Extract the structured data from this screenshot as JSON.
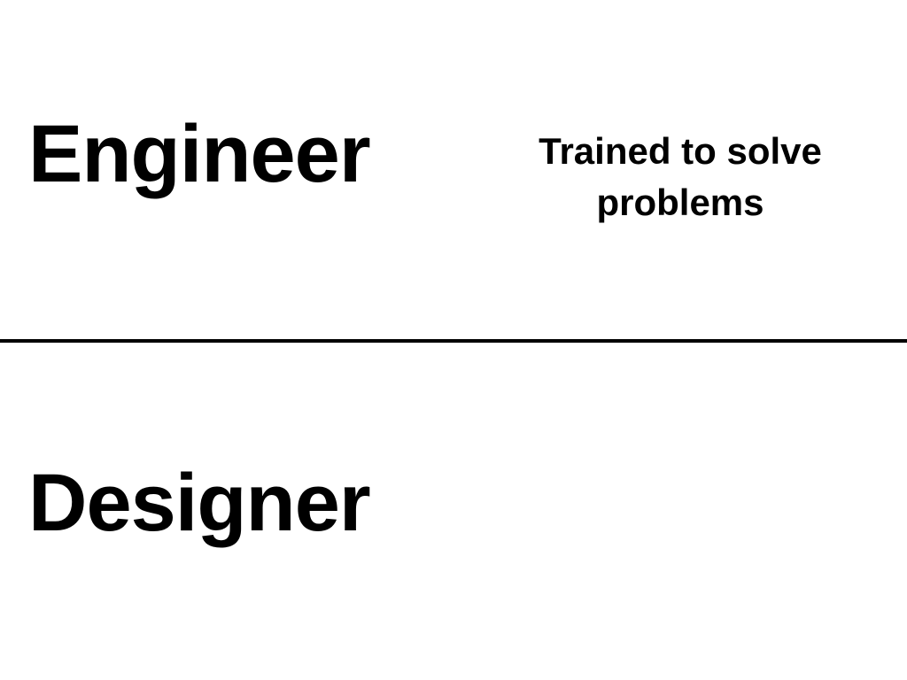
{
  "slide": {
    "top_section": {
      "title": "Engineer",
      "description": "Trained to solve\nproblems"
    },
    "bottom_section": {
      "title": "Designer"
    },
    "colors": {
      "background": "#ffffff",
      "text": "#000000",
      "divider": "#000000"
    }
  }
}
